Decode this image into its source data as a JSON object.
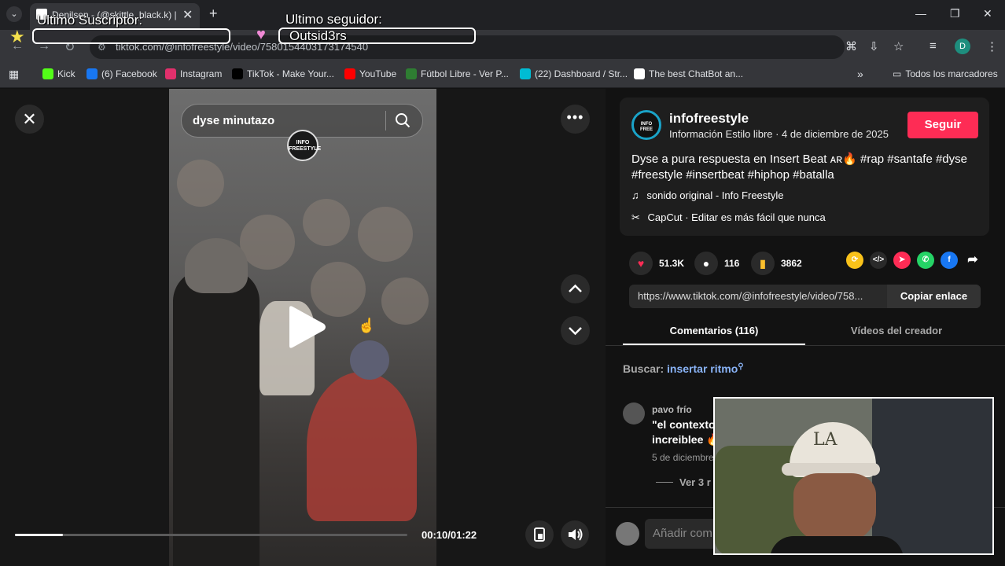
{
  "browser": {
    "tab_title": "Denilsen - (@skittle_black.k) |",
    "url": "tiktok.com/@infofreestyle/video/7580154403173174540",
    "profile_initial": "D",
    "bookmarks": [
      {
        "label": "Kick",
        "icon": "kick-icon",
        "color": "#53fc18"
      },
      {
        "label": "(6) Facebook",
        "icon": "facebook-icon",
        "color": "#1877f2"
      },
      {
        "label": "Instagram",
        "icon": "instagram-icon",
        "color": "#e1306c"
      },
      {
        "label": "TikTok - Make Your...",
        "icon": "tiktok-icon",
        "color": "#000000"
      },
      {
        "label": "YouTube",
        "icon": "youtube-icon",
        "color": "#ff0000"
      },
      {
        "label": "Fútbol Libre - Ver P...",
        "icon": "futbol-icon",
        "color": "#2e7d32"
      },
      {
        "label": "(22) Dashboard / Str...",
        "icon": "dashboard-icon",
        "color": "#00bcd4"
      },
      {
        "label": "The best ChatBot an...",
        "icon": "chatbot-icon",
        "color": "#ffffff"
      }
    ],
    "all_bookmarks_label": "Todos los marcadores"
  },
  "overlay": {
    "subscriber_label": "Ultimo Suscriptor:",
    "subscriber_value": "",
    "follower_label": "Ultimo seguidor:",
    "follower_value": "Outsid3rs"
  },
  "video": {
    "search_query": "dyse minutazo",
    "logo_text": "INFO FREESTYLE",
    "time": "00:10/01:22",
    "progress": 0.122
  },
  "post": {
    "author": "infofreestyle",
    "author_sub": "Información Estilo libre · 4 de diciembre de 2025",
    "follow_label": "Seguir",
    "description": "Dyse a pura respuesta en Insert Beat ᴀʀ🔥 #rap #santafe #dyse #freestyle #insertbeat #hiphop #batalla",
    "music": "sonido original - Info Freestyle",
    "capcut": "CapCut · Editar es más fácil que nunca",
    "likes": "51.3K",
    "comments": "116",
    "saves": "3862",
    "link": "https://www.tiktok.com/@infofreestyle/video/758...",
    "copy_label": "Copiar enlace"
  },
  "tabs": {
    "comments": "Comentarios (116)",
    "creator_videos": "Vídeos del creador"
  },
  "search_hint": {
    "prefix": "Buscar:",
    "term": "insertar ritmo"
  },
  "comment": {
    "user": "pavo frío",
    "text_line1": "\"el contexto",
    "text_line2": "increiblee 🔥",
    "date": "5 de diciembre",
    "replies": "Ver 3 r"
  },
  "add_comment_placeholder": "Añadir com"
}
